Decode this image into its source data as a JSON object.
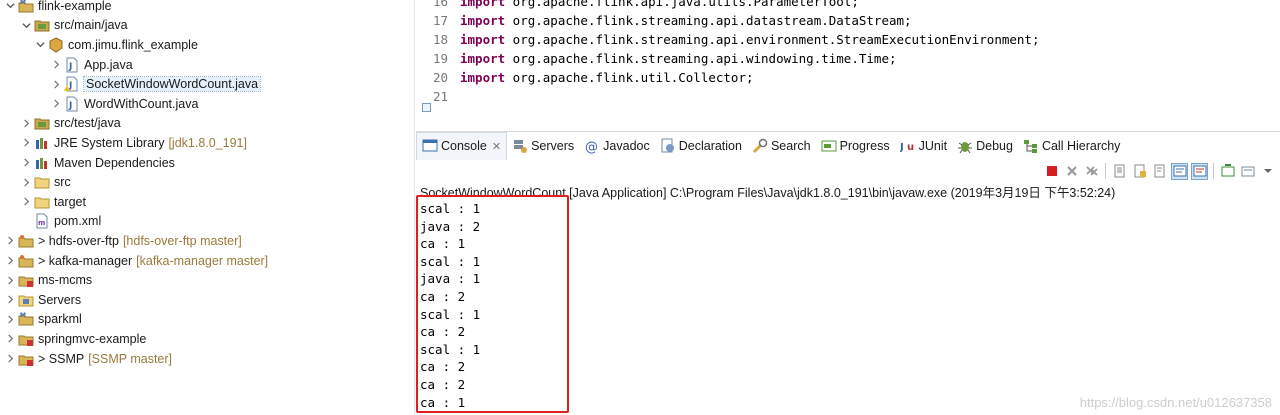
{
  "project_tree": {
    "items": [
      {
        "label": "flink-example",
        "decoration": "",
        "twisty": "open"
      },
      {
        "label": "src/main/java",
        "decoration": "",
        "twisty": "open"
      },
      {
        "label": "com.jimu.flink_example",
        "decoration": "",
        "twisty": "open"
      },
      {
        "label": "App.java",
        "decoration": "",
        "twisty": "closed"
      },
      {
        "label": "SocketWindowWordCount.java",
        "decoration": "",
        "twisty": "closed"
      },
      {
        "label": "WordWithCount.java",
        "decoration": "",
        "twisty": "closed"
      },
      {
        "label": "src/test/java",
        "decoration": "",
        "twisty": "closed"
      },
      {
        "label": "JRE System Library",
        "decoration": "[jdk1.8.0_191]",
        "twisty": "closed"
      },
      {
        "label": "Maven Dependencies",
        "decoration": "",
        "twisty": "closed"
      },
      {
        "label": "src",
        "decoration": "",
        "twisty": "closed"
      },
      {
        "label": "target",
        "decoration": "",
        "twisty": "closed"
      },
      {
        "label": "pom.xml",
        "decoration": "",
        "twisty": "none"
      },
      {
        "label": "> hdfs-over-ftp",
        "decoration": "[hdfs-over-ftp master]",
        "twisty": "closed"
      },
      {
        "label": "> kafka-manager",
        "decoration": "[kafka-manager master]",
        "twisty": "closed"
      },
      {
        "label": "ms-mcms",
        "decoration": "",
        "twisty": "closed"
      },
      {
        "label": "Servers",
        "decoration": "",
        "twisty": "closed"
      },
      {
        "label": "sparkml",
        "decoration": "",
        "twisty": "closed"
      },
      {
        "label": "springmvc-example",
        "decoration": "",
        "twisty": "closed"
      },
      {
        "label": "> SSMP",
        "decoration": "[SSMP master]",
        "twisty": "closed"
      }
    ]
  },
  "editor": {
    "lines": [
      {
        "number": "16",
        "keyword": "import",
        "rest": " org.apache.flink.api.java.utils.ParameterTool;"
      },
      {
        "number": "17",
        "keyword": "import",
        "rest": " org.apache.flink.streaming.api.datastream.DataStream;"
      },
      {
        "number": "18",
        "keyword": "import",
        "rest": " org.apache.flink.streaming.api.environment.StreamExecutionEnvironment;"
      },
      {
        "number": "19",
        "keyword": "import",
        "rest": " org.apache.flink.streaming.api.windowing.time.Time;"
      },
      {
        "number": "20",
        "keyword": "import",
        "rest": " org.apache.flink.util.Collector;"
      },
      {
        "number": "21",
        "keyword": "",
        "rest": ""
      }
    ]
  },
  "console": {
    "tabs": [
      {
        "label": "Console",
        "icon": "console-icon"
      },
      {
        "label": "Servers",
        "icon": "servers-icon"
      },
      {
        "label": "Javadoc",
        "icon": "javadoc-icon"
      },
      {
        "label": "Declaration",
        "icon": "declaration-icon"
      },
      {
        "label": "Search",
        "icon": "search-icon"
      },
      {
        "label": "Progress",
        "icon": "progress-icon"
      },
      {
        "label": "JUnit",
        "icon": "junit-icon"
      },
      {
        "label": "Debug",
        "icon": "debug-icon"
      },
      {
        "label": "Call Hierarchy",
        "icon": "call-hierarchy-icon"
      }
    ],
    "launch_description": "SocketWindowWordCount [Java Application] C:\\Program Files\\Java\\jdk1.8.0_191\\bin\\javaw.exe (2019年3月19日 下午3:52:24)",
    "output_lines": [
      "scal : 1",
      "java : 2",
      "ca : 1",
      "scal : 1",
      "java : 1",
      "ca : 2",
      "scal : 1",
      "ca : 2",
      "scal : 1",
      "ca : 2",
      "ca : 2",
      "ca : 1"
    ]
  },
  "watermark": "https://blog.csdn.net/u012637358",
  "colors": {
    "keyword": "#7f0055",
    "decoration": "#9b7a3c",
    "highlight_box": "#e02020",
    "terminate": "#d42020"
  }
}
